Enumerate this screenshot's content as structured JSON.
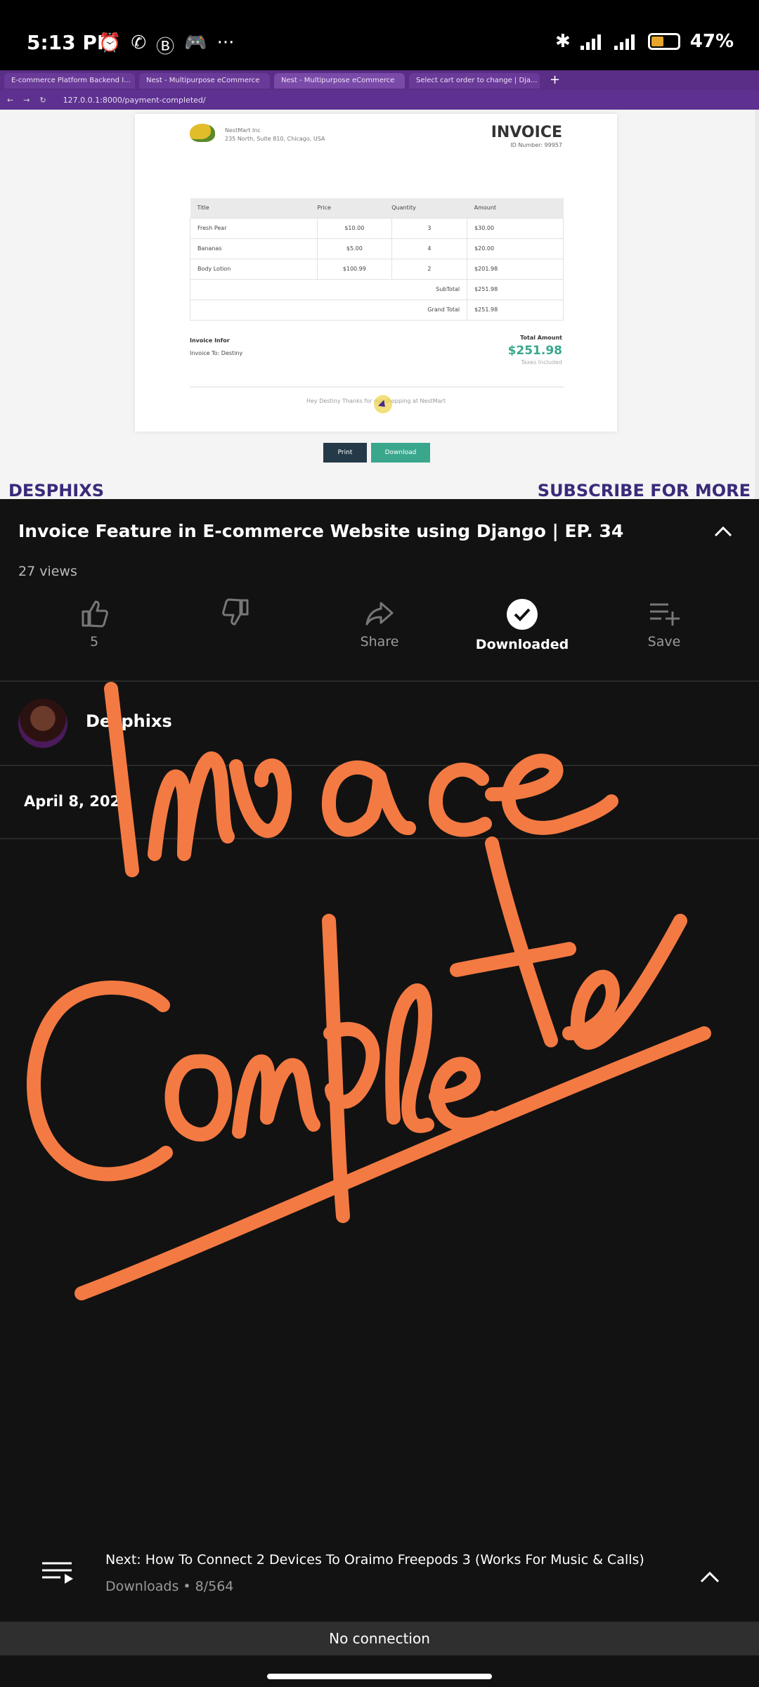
{
  "status_bar": {
    "time": "5:13 PM",
    "notification_icons": [
      "alarm-icon",
      "whatsapp-icon",
      "b-icon",
      "game-controller-icon",
      "more-dots-icon"
    ],
    "more": "···",
    "battery_percent": "47%",
    "battery_level": 0.47
  },
  "browser": {
    "tabs": [
      "E-commerce Platform Backend I...",
      "Nest - Multipurpose eCommerce",
      "Nest - Multipurpose eCommerce",
      "Select cart order to change | Dja..."
    ],
    "url": "127.0.0.1:8000/payment-completed/"
  },
  "invoice": {
    "company_name": "NestMart Inc",
    "company_address": "235 North, Suite 810, Chicago, USA",
    "title": "INVOICE",
    "id_label": "ID Number: 99957",
    "headers": [
      "Title",
      "Price",
      "Quantity",
      "Amount"
    ],
    "rows": [
      [
        "Fresh Pear",
        "$10.00",
        "3",
        "$30.00"
      ],
      [
        "Bananas",
        "$5.00",
        "4",
        "$20.00"
      ],
      [
        "Body Lotion",
        "$100.99",
        "2",
        "$201.98"
      ]
    ],
    "subtotal_label": "SubTotal",
    "subtotal": "$251.98",
    "grand_total_label": "Grand Total",
    "grand_total": "$251.98",
    "info_label": "Invoice Infor",
    "invoice_to": "Invoice To: Destiny",
    "total_amount_label": "Total Amount",
    "total_amount": "$251.98",
    "taxes": "Taxes Included",
    "thanks": "Hey Destiny Thanks for our shopping at NestMart",
    "print_label": "Print",
    "download_label": "Download",
    "watermark_left": "DESPHIXS",
    "watermark_right": "SUBSCRIBE FOR MORE"
  },
  "video_meta": {
    "title": "Invoice Feature in E-commerce Website using Django | EP. 34",
    "views": "27 views",
    "actions": [
      {
        "icon": "thumbs-up-icon",
        "label": "5"
      },
      {
        "icon": "thumbs-down-icon",
        "label": ""
      },
      {
        "icon": "share-icon",
        "label": "Share"
      },
      {
        "icon": "downloaded-check-icon",
        "label": "Downloaded"
      },
      {
        "icon": "save-playlist-icon",
        "label": "Save"
      }
    ],
    "channel": "Desphixs",
    "date": "April 8, 2023"
  },
  "next": {
    "title": "Next: How To Connect 2 Devices To Oraimo Freepods 3 (Works For Music & Calls)",
    "subtitle": "Downloads • 8/564"
  },
  "connection_status": "No connection",
  "colors": {
    "accent_green": "#3aa78d",
    "scribble_orange": "#f47a43",
    "browser_purple": "#5a2e86",
    "panel_bg": "#121212"
  }
}
